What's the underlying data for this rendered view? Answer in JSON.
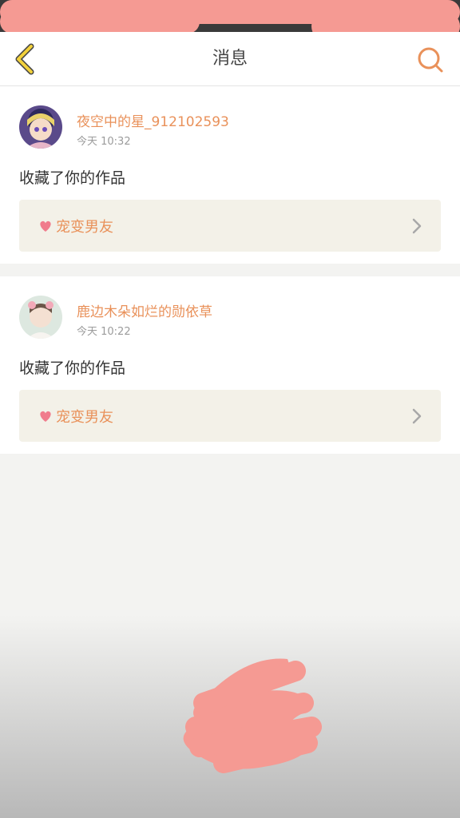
{
  "header": {
    "title": "消息"
  },
  "messages": [
    {
      "username": "夜空中的星_912102593",
      "time": "今天 10:32",
      "action": "收藏了你的作品",
      "work_title": "宠变男友"
    },
    {
      "username": "鹿边木朵如烂的勋依草",
      "time": "今天 10:22",
      "action": "收藏了你的作品",
      "work_title": "宠变男友"
    }
  ],
  "colors": {
    "accent": "#e9915a",
    "back_icon": "#f2d13c",
    "heart_icon": "#f07c8c",
    "redaction": "#f59a93"
  },
  "icons": [
    "back-arrow-icon",
    "search-icon",
    "heart-icon",
    "chevron-right-icon"
  ]
}
